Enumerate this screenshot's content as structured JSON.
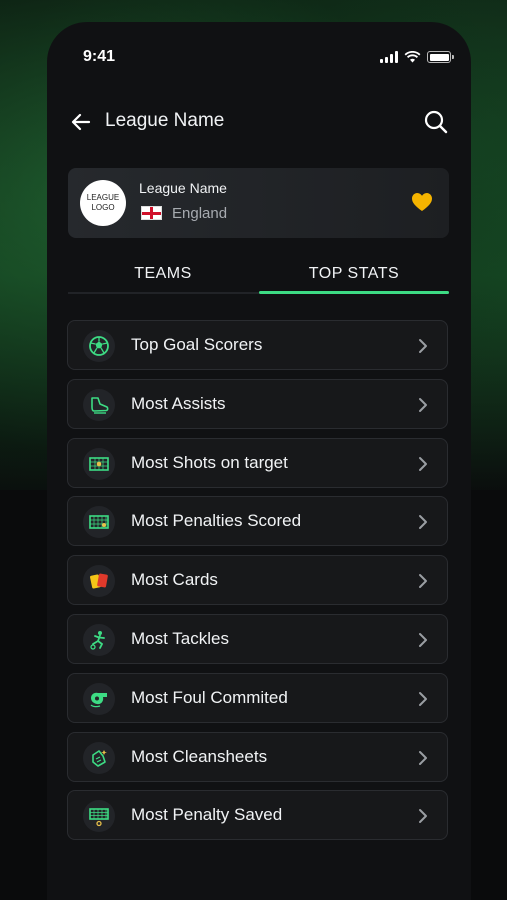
{
  "status": {
    "time": "9:41"
  },
  "header": {
    "title": "League Name"
  },
  "league": {
    "logo_text": "LEAGUE LOGO",
    "name": "League Name",
    "country": "England",
    "favorite_color": "#f5b400"
  },
  "tabs": [
    {
      "label": "TEAMS",
      "active": false
    },
    {
      "label": "TOP STATS",
      "active": true
    }
  ],
  "accent_color": "#3ddc84",
  "stats": [
    {
      "label": "Top Goal Scorers",
      "icon": "soccer-ball-icon"
    },
    {
      "label": "Most Assists",
      "icon": "boot-icon"
    },
    {
      "label": "Most Shots on target",
      "icon": "goal-target-icon"
    },
    {
      "label": "Most Penalties Scored",
      "icon": "goal-net-icon"
    },
    {
      "label": "Most Cards",
      "icon": "cards-icon"
    },
    {
      "label": "Most Tackles",
      "icon": "tackle-icon"
    },
    {
      "label": "Most Foul Commited",
      "icon": "whistle-icon"
    },
    {
      "label": "Most Cleansheets",
      "icon": "gloves-icon"
    },
    {
      "label": "Most Penalty Saved",
      "icon": "goal-save-icon"
    }
  ]
}
